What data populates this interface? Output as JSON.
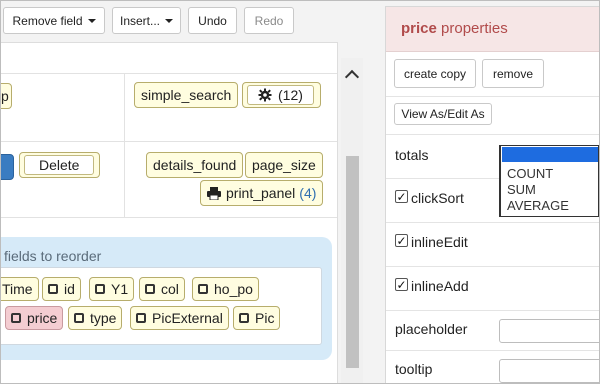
{
  "toolbar": {
    "remove_field": "Remove field",
    "insert": "Insert...",
    "undo": "Undo",
    "redo": "Redo"
  },
  "left": {
    "row1_partial": "p",
    "simple_search": "simple_search",
    "gear_count": "(12)",
    "delete": "Delete",
    "details_found": "details_found",
    "page_size": "page_size",
    "print_panel": "print_panel",
    "print_panel_count": "(4)",
    "reorder_title": "fields to reorder",
    "fields": [
      "Time",
      "id",
      "Y1",
      "col",
      "ho_po",
      "price",
      "type",
      "PicExternal",
      "Pic"
    ]
  },
  "properties": {
    "field_name": "price",
    "title_suffix": "properties",
    "create_copy": "create copy",
    "remove": "remove",
    "view_as": "View As/Edit As",
    "totals_label": "totals",
    "totals_options": [
      "",
      "COUNT",
      "SUM",
      "AVERAGE"
    ],
    "clicksort": "clickSort",
    "inlineedit": "inlineEdit",
    "inlineadd": "inlineAdd",
    "placeholder_label": "placeholder",
    "tooltip_label": "tooltip",
    "check_mark": "✓"
  },
  "colors": {
    "accent_header": "#b14b4b",
    "selected_option": "#1e6ce0",
    "reorder_panel": "#d6eaf8"
  }
}
